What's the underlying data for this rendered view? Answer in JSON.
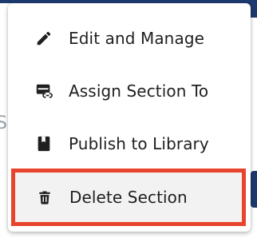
{
  "menu": {
    "items": [
      {
        "label": "Edit and Manage",
        "icon": "pencil-icon"
      },
      {
        "label": "Assign Section To",
        "icon": "assign-link-icon"
      },
      {
        "label": "Publish to Library",
        "icon": "book-icon"
      },
      {
        "label": "Delete Section",
        "icon": "trash-icon",
        "highlighted": true
      }
    ]
  },
  "background": {
    "partial_text": "S"
  },
  "colors": {
    "highlight_border": "#e8432d",
    "highlight_bg": "#f2f2f2",
    "text": "#1f1f1f",
    "nav": "#1d3a6f"
  }
}
